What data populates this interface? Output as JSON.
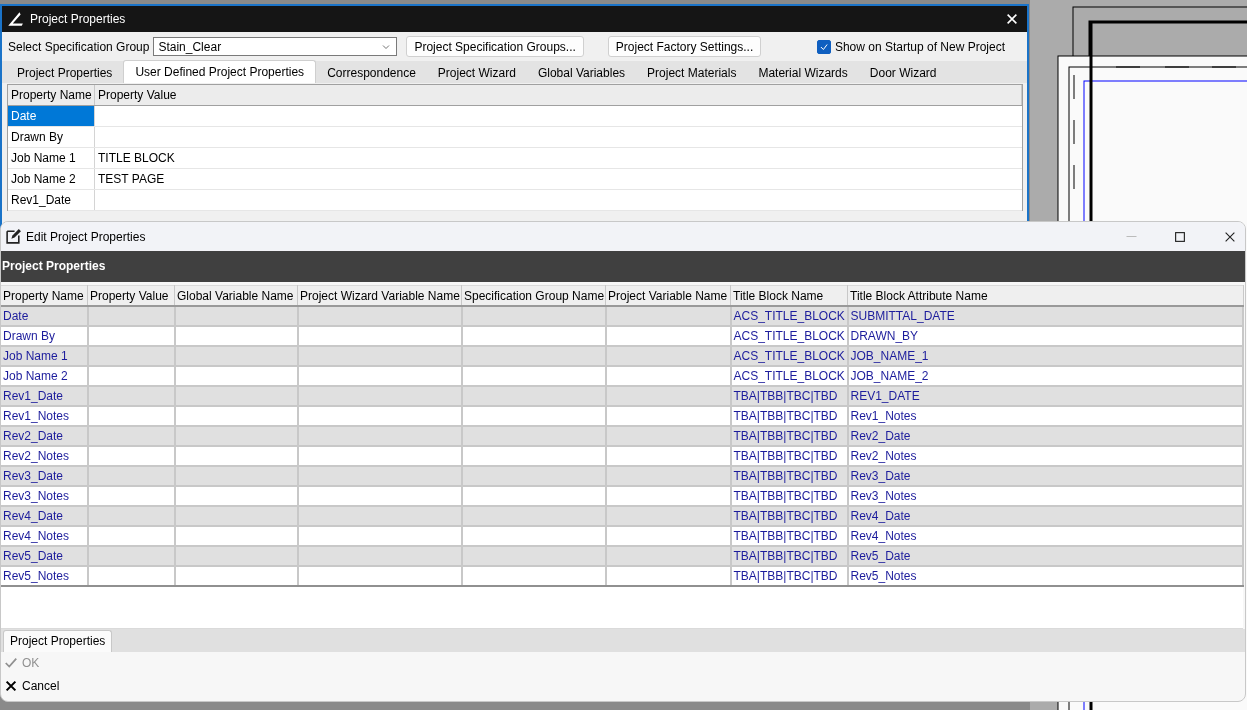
{
  "back_window": {
    "title": "Project Properties",
    "spec_group_label": "Select Specification Group",
    "spec_group_value": "Stain_Clear",
    "buttons": [
      "Project Specification Groups...",
      "Project Factory Settings..."
    ],
    "startup_checkbox": {
      "label": "Show on Startup of New Project",
      "checked": true
    },
    "tabs": [
      {
        "label": "Project Properties",
        "selected": false
      },
      {
        "label": "User Defined Project Properties",
        "selected": true
      },
      {
        "label": "Correspondence",
        "selected": false
      },
      {
        "label": "Project Wizard",
        "selected": false
      },
      {
        "label": "Global Variables",
        "selected": false
      },
      {
        "label": "Project Materials",
        "selected": false
      },
      {
        "label": "Material Wizards",
        "selected": false
      },
      {
        "label": "Door Wizard",
        "selected": false
      }
    ],
    "grid": {
      "columns": [
        "Property Name",
        "Property Value"
      ],
      "rows": [
        {
          "name": "Date",
          "value": "",
          "selected": true
        },
        {
          "name": "Drawn By",
          "value": "",
          "selected": false
        },
        {
          "name": "Job Name 1",
          "value": "TITLE BLOCK",
          "selected": false
        },
        {
          "name": "Job Name 2",
          "value": "TEST PAGE",
          "selected": false
        },
        {
          "name": "Rev1_Date",
          "value": "",
          "selected": false
        }
      ]
    }
  },
  "front_window": {
    "title": "Edit Project Properties",
    "header": "Project Properties",
    "table": {
      "columns": [
        "Property Name",
        "Property Value",
        "Global Variable Name",
        "Project Wizard Variable Name",
        "Specification Group Name",
        "Project Variable Name",
        "Title Block Name",
        "Title Block Attribute Name"
      ],
      "rows": [
        [
          "Date",
          "",
          "",
          "",
          "",
          "",
          "ACS_TITLE_BLOCK",
          "SUBMITTAL_DATE"
        ],
        [
          "Drawn By",
          "",
          "",
          "",
          "",
          "",
          "ACS_TITLE_BLOCK",
          "DRAWN_BY"
        ],
        [
          "Job Name 1",
          "",
          "",
          "",
          "",
          "",
          "ACS_TITLE_BLOCK",
          "JOB_NAME_1"
        ],
        [
          "Job Name 2",
          "",
          "",
          "",
          "",
          "",
          "ACS_TITLE_BLOCK",
          "JOB_NAME_2"
        ],
        [
          "Rev1_Date",
          "",
          "",
          "",
          "",
          "",
          "TBA|TBB|TBC|TBD",
          "REV1_DATE"
        ],
        [
          "Rev1_Notes",
          "",
          "",
          "",
          "",
          "",
          "TBA|TBB|TBC|TBD",
          "Rev1_Notes"
        ],
        [
          "Rev2_Date",
          "",
          "",
          "",
          "",
          "",
          "TBA|TBB|TBC|TBD",
          "Rev2_Date"
        ],
        [
          "Rev2_Notes",
          "",
          "",
          "",
          "",
          "",
          "TBA|TBB|TBC|TBD",
          "Rev2_Notes"
        ],
        [
          "Rev3_Date",
          "",
          "",
          "",
          "",
          "",
          "TBA|TBB|TBC|TBD",
          "Rev3_Date"
        ],
        [
          "Rev3_Notes",
          "",
          "",
          "",
          "",
          "",
          "TBA|TBB|TBC|TBD",
          "Rev3_Notes"
        ],
        [
          "Rev4_Date",
          "",
          "",
          "",
          "",
          "",
          "TBA|TBB|TBC|TBD",
          "Rev4_Date"
        ],
        [
          "Rev4_Notes",
          "",
          "",
          "",
          "",
          "",
          "TBA|TBB|TBC|TBD",
          "Rev4_Notes"
        ],
        [
          "Rev5_Date",
          "",
          "",
          "",
          "",
          "",
          "TBA|TBB|TBC|TBD",
          "Rev5_Date"
        ],
        [
          "Rev5_Notes",
          "",
          "",
          "",
          "",
          "",
          "TBA|TBB|TBC|TBD",
          "Rev5_Notes"
        ]
      ]
    },
    "bottom_tabs": [
      {
        "label": "Project Properties",
        "selected": true
      }
    ],
    "actions": [
      {
        "kind": "ok",
        "label": "OK",
        "disabled": true
      },
      {
        "kind": "cancel",
        "label": "Cancel",
        "disabled": false
      }
    ]
  }
}
